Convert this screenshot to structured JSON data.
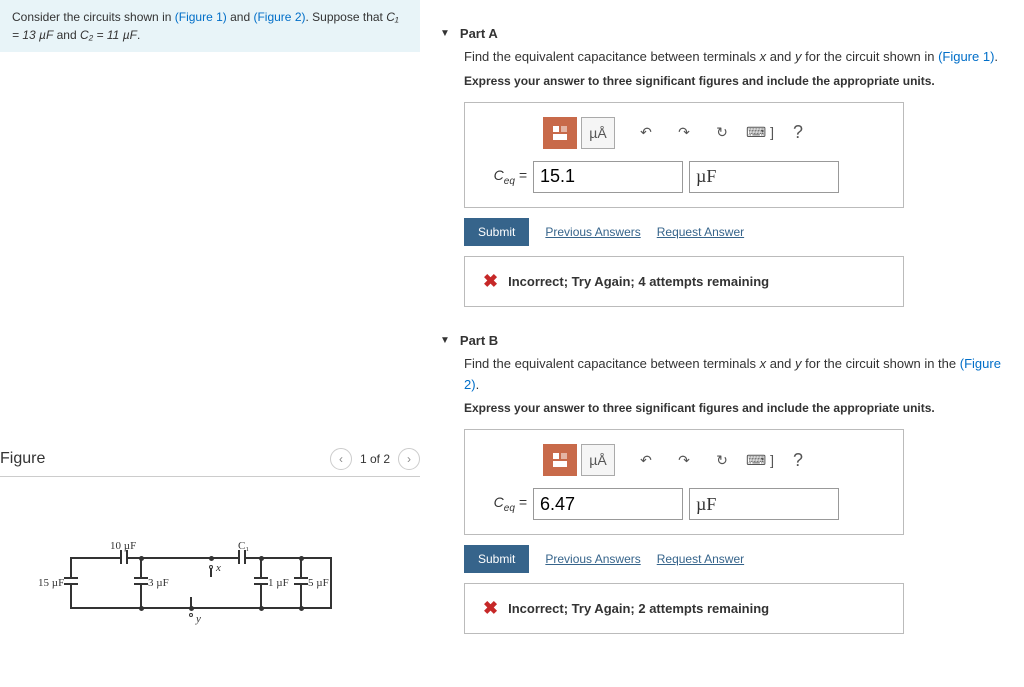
{
  "problem": {
    "text_pre": "Consider the circuits shown in ",
    "fig1": "(Figure 1)",
    "text_mid": " and ",
    "fig2": "(Figure 2)",
    "text_post": ". Suppose that ",
    "c1_expr": "C₁ = 13 µF",
    "and": " and ",
    "c2_expr": "C₂ = 11 µF",
    "period": "."
  },
  "figure": {
    "title": "Figure",
    "pager": "1 of 2",
    "labels": {
      "c10": "10 µF",
      "c1": "C₁",
      "c15": "15 µF",
      "c3": "3 µF",
      "c1uf": "1 µF",
      "c5": "5 µF",
      "x": "x",
      "y": "y"
    }
  },
  "partA": {
    "title": "Part A",
    "prompt_pre": "Find the equivalent capacitance between terminals ",
    "var_x": "x",
    "prompt_mid1": " and ",
    "var_y": "y",
    "prompt_mid2": " for the circuit shown in ",
    "fig_link": "(Figure 1)",
    "prompt_post": ".",
    "instruct": "Express your answer to three significant figures and include the appropriate units.",
    "toolbar": {
      "units_btn": "µÅ",
      "help": "?"
    },
    "var_label": "Ceq",
    "equals": " = ",
    "value": "15.1",
    "unit": "µF",
    "submit": "Submit",
    "prev": "Previous Answers",
    "req": "Request Answer",
    "feedback": "Incorrect; Try Again; 4 attempts remaining"
  },
  "partB": {
    "title": "Part B",
    "prompt_pre": "Find the equivalent capacitance between terminals ",
    "var_x": "x",
    "prompt_mid1": " and ",
    "var_y": "y",
    "prompt_mid2": " for the circuit shown in the ",
    "fig_link": "(Figure 2)",
    "prompt_post": ".",
    "instruct": "Express your answer to three significant figures and include the appropriate units.",
    "toolbar": {
      "units_btn": "µÅ",
      "help": "?"
    },
    "var_label": "Ceq",
    "equals": " = ",
    "value": "6.47",
    "unit": "µF",
    "submit": "Submit",
    "prev": "Previous Answers",
    "req": "Request Answer",
    "feedback": "Incorrect; Try Again; 2 attempts remaining"
  }
}
